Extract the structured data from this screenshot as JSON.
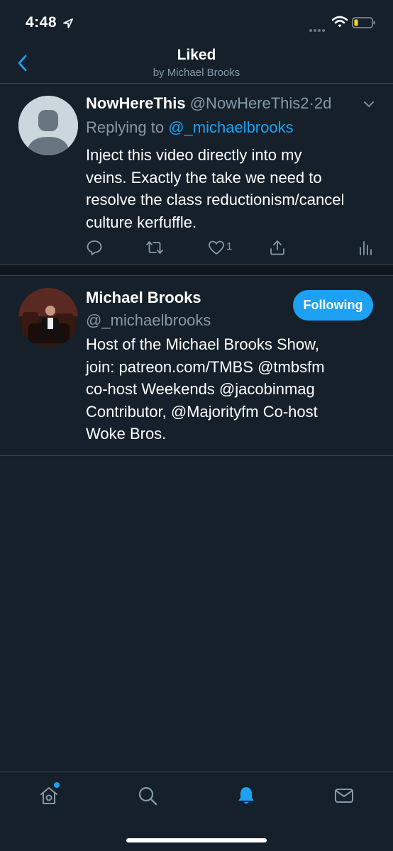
{
  "status_bar": {
    "time": "4:48"
  },
  "header": {
    "title": "Liked",
    "subtitle": "by Michael Brooks"
  },
  "tweet": {
    "name": "NowHereThis",
    "handle": "@NowHereThis2",
    "separator": "·",
    "time": "2d",
    "replying_prefix": "Replying to ",
    "replying_to": "@_michaelbrooks",
    "body_lines": [
      "Inject this video directly into my",
      "veins. Exactly the take we need to",
      "resolve the class reductionism/cancel",
      "culture kerfuffle."
    ],
    "like_count": "1",
    "icons": [
      "reply-icon",
      "retweet-icon",
      "like-icon",
      "share-icon",
      "analytics-icon"
    ]
  },
  "user": {
    "name": "Michael Brooks",
    "handle": "@_michaelbrooks",
    "follow_label": "Following",
    "bio_lines": [
      "Host of the Michael Brooks Show,",
      "join: patreon.com/TMBS @tmbsfm",
      "co-host Weekends @jacobinmag",
      "Contributor, @Majorityfm Co-host",
      "Woke Bros."
    ]
  },
  "tabs": [
    {
      "name": "home",
      "icon": "home-icon",
      "active": false
    },
    {
      "name": "search",
      "icon": "search-icon",
      "active": false
    },
    {
      "name": "notifications",
      "icon": "bell-icon",
      "active": true
    },
    {
      "name": "messages",
      "icon": "mail-icon",
      "active": false
    }
  ],
  "colors": {
    "background": "#15202b",
    "accent": "#1da1f2",
    "secondary_text": "#8899a6",
    "divider": "#38444d"
  }
}
